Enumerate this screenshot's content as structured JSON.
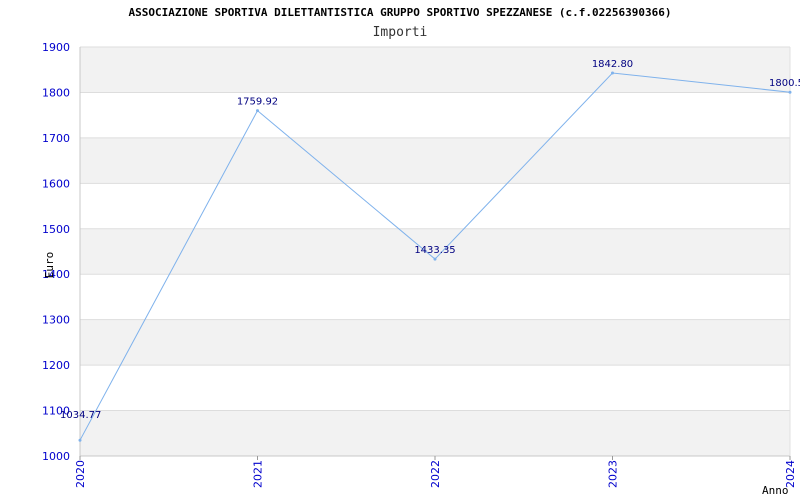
{
  "chart_data": {
    "type": "line",
    "title": "ASSOCIAZIONE SPORTIVA DILETTANTISTICA GRUPPO SPORTIVO SPEZZANESE (c.f.02256390366)",
    "subtitle": "Importi",
    "xlabel": "Anno",
    "ylabel": "Euro",
    "x": [
      "2020",
      "2021",
      "2022",
      "2023",
      "2024"
    ],
    "series": [
      {
        "values": [
          1034.77,
          1759.92,
          1433.35,
          1842.8,
          1800.5
        ],
        "labels": [
          "1034.77",
          "1759.92",
          "1433.35",
          "1842.80",
          "1800.5"
        ]
      }
    ],
    "ylim": [
      1000,
      1900
    ],
    "yticks": [
      1000,
      1100,
      1200,
      1300,
      1400,
      1500,
      1600,
      1700,
      1800,
      1900
    ],
    "grid": true,
    "colors": {
      "line": "#7fb2ec",
      "band": "#f2f2f2",
      "tick_text": "#0000cc",
      "data_label": "#000080"
    }
  }
}
